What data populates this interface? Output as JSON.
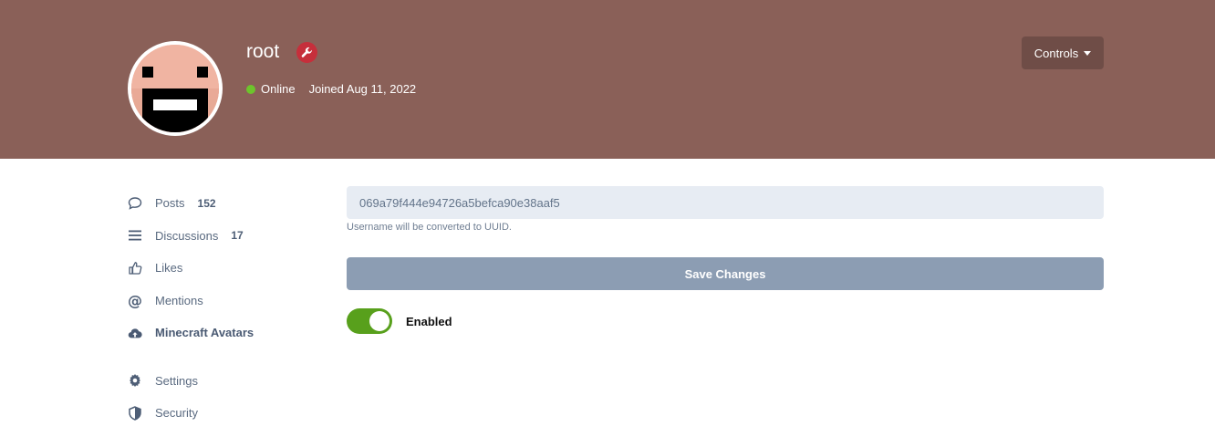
{
  "profile": {
    "username": "root",
    "status": "Online",
    "joined": "Joined Aug 11, 2022",
    "avatar_icon": "minecraft-face",
    "badge_icon": "wrench-icon"
  },
  "header": {
    "controls_label": "Controls",
    "background": "#8a6058"
  },
  "sidebar": {
    "items": [
      {
        "label": "Posts",
        "count": "152",
        "icon": "comment-icon"
      },
      {
        "label": "Discussions",
        "count": "17",
        "icon": "list-icon"
      },
      {
        "label": "Likes",
        "icon": "thumbs-up-icon"
      },
      {
        "label": "Mentions",
        "icon": "at-icon"
      },
      {
        "label": "Minecraft Avatars",
        "icon": "cloud-upload-icon",
        "active": true
      },
      {
        "label": "Settings",
        "icon": "gear-icon"
      },
      {
        "label": "Security",
        "icon": "shield-icon"
      }
    ]
  },
  "form": {
    "uuid_value": "069a79f444e94726a5befca90e38aaf5",
    "helper_text": "Username will be converted to UUID.",
    "save_label": "Save Changes",
    "toggle_label": "Enabled",
    "toggle_on": true
  },
  "colors": {
    "accent_toggle": "#58a01c",
    "badge": "#c62f3b",
    "online": "#6dc42c"
  }
}
